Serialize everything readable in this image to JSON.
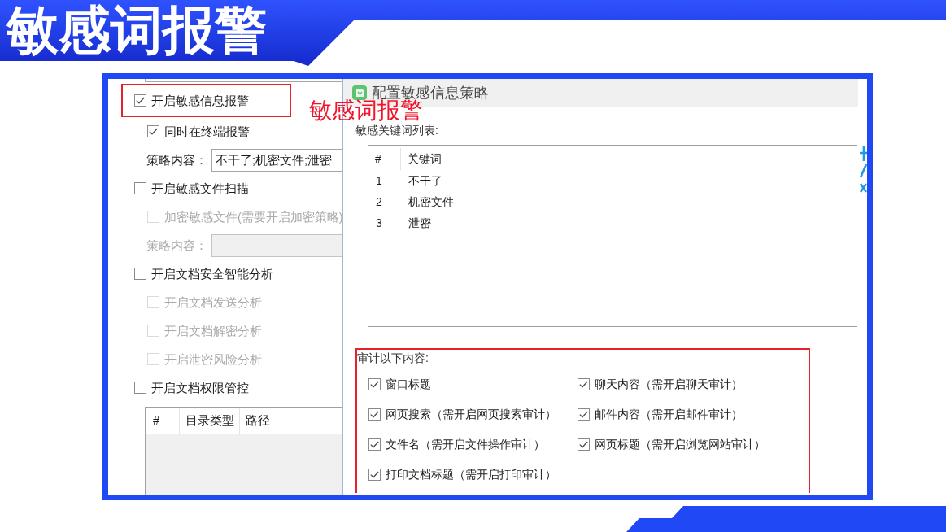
{
  "banner": {
    "title": "敏感词报警"
  },
  "annotation": {
    "text": "敏感词报警"
  },
  "settings_panel": {
    "items": [
      {
        "kind": "checkbox",
        "label": "开启敏感信息报警",
        "checked": true,
        "disabled": false,
        "highlighted": true,
        "children": [
          {
            "kind": "checkbox",
            "label": "同时在终端报警",
            "checked": true,
            "disabled": false
          },
          {
            "kind": "field",
            "label": "策略内容：",
            "value": "不干了;机密文件;泄密",
            "disabled": false
          }
        ]
      },
      {
        "kind": "checkbox",
        "label": "开启敏感文件扫描",
        "checked": false,
        "disabled": false,
        "highlighted": false,
        "children": [
          {
            "kind": "checkbox",
            "label": "加密敏感文件(需要开启加密策略)",
            "checked": false,
            "disabled": true
          },
          {
            "kind": "field",
            "label": "策略内容：",
            "disabled": true
          }
        ]
      },
      {
        "kind": "checkbox",
        "label": "开启文档安全智能分析",
        "checked": false,
        "disabled": false,
        "highlighted": false,
        "children": [
          {
            "kind": "checkbox",
            "label": "开启文档发送分析",
            "checked": false,
            "disabled": true
          },
          {
            "kind": "checkbox",
            "label": "开启文档解密分析",
            "checked": false,
            "disabled": true
          },
          {
            "kind": "checkbox",
            "label": "开启泄密风险分析",
            "checked": false,
            "disabled": true
          }
        ]
      },
      {
        "kind": "checkbox",
        "label": "开启文档权限管控",
        "checked": false,
        "disabled": false,
        "highlighted": false
      }
    ],
    "table": {
      "columns": [
        "#",
        "目录类型",
        "路径"
      ]
    }
  },
  "dialog": {
    "title": "配置敏感信息策略",
    "keyword_list": {
      "label": "敏感关键词列表:",
      "columns": [
        "#",
        "关键词"
      ],
      "rows": [
        {
          "number": "1",
          "keyword": "不干了"
        },
        {
          "number": "2",
          "keyword": "机密文件"
        },
        {
          "number": "3",
          "keyword": "泄密"
        }
      ]
    },
    "audit": {
      "label": "审计以下内容:",
      "highlighted": true,
      "options": [
        {
          "label": "窗口标题",
          "checked": true
        },
        {
          "label": "聊天内容（需开启聊天审计）",
          "checked": true
        },
        {
          "label": "网页搜索（需开启网页搜索审计）",
          "checked": true
        },
        {
          "label": "邮件内容（需开启邮件审计）",
          "checked": true
        },
        {
          "label": "文件名（需开启文件操作审计）",
          "checked": true
        },
        {
          "label": "网页标题（需开启浏览网站审计）",
          "checked": true
        },
        {
          "label": "打印文档标题（需开启打印审计）",
          "checked": true
        }
      ]
    }
  }
}
